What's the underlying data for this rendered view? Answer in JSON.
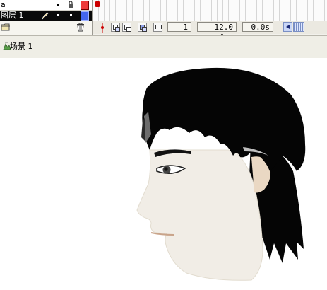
{
  "timeline": {
    "layers": [
      {
        "name": "a",
        "selected": false
      },
      {
        "name": "图层 1",
        "selected": true
      }
    ],
    "frame_rate": "12.0 fps",
    "current_frame": "1",
    "elapsed_time": "0.0s"
  },
  "scene": {
    "label": "场景 1"
  },
  "colors": {
    "panel_bg": "#f2f1ec",
    "selected_layer_bg": "#0a0a0a",
    "playhead": "#cc0000",
    "hair": "#050505",
    "skin": "#f1ede6",
    "ear": "#ead8c3"
  },
  "icons": [
    "pencil-icon",
    "lock-icon",
    "add-folder-icon",
    "trash-icon",
    "onion-skin-icon",
    "edit-multiple-frames-icon",
    "scene-icon"
  ]
}
